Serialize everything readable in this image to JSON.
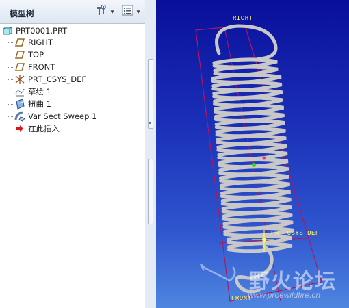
{
  "model_tree": {
    "title": "模型树",
    "header_icons": [
      "settings-tools-icon",
      "show-list-icon"
    ],
    "root": {
      "label": "PRT0001.PRT",
      "icon": "part-icon"
    },
    "items": [
      {
        "label": "RIGHT",
        "icon": "datum-plane-icon"
      },
      {
        "label": "TOP",
        "icon": "datum-plane-icon"
      },
      {
        "label": "FRONT",
        "icon": "datum-plane-icon"
      },
      {
        "label": "PRT_CSYS_DEF",
        "icon": "coordinate-system-icon"
      },
      {
        "label": "草绘 1",
        "icon": "sketch-icon"
      },
      {
        "label": "扭曲 1",
        "icon": "warp-icon"
      },
      {
        "label": "Var Sect Sweep 1",
        "icon": "sweep-icon"
      },
      {
        "label": "在此插入",
        "icon": "insert-here-arrow-icon"
      }
    ]
  },
  "viewport": {
    "labels": {
      "right": "RIGHT",
      "csys": "PRT_CSYS_DEF",
      "front": "FRONT"
    },
    "watermark": {
      "text": "野火论坛",
      "url": "www.proewildfire.cn"
    },
    "colors": {
      "datum": "#ffff55",
      "frame": "#b0185a",
      "spring": "#c8c8c8"
    }
  }
}
